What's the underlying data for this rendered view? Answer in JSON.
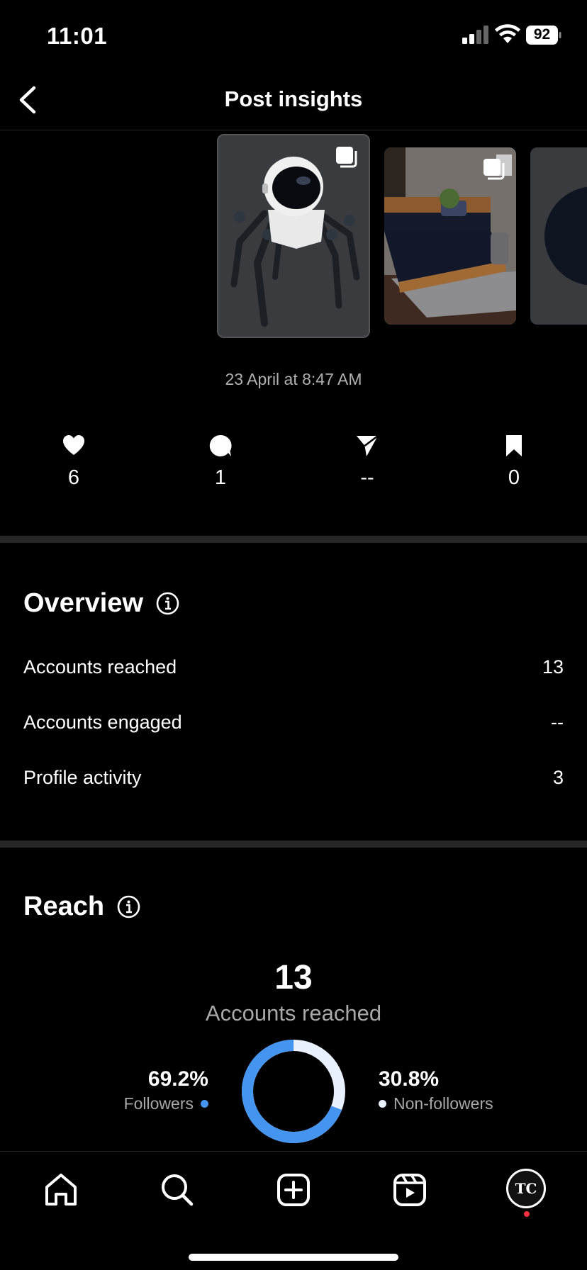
{
  "status_bar": {
    "time": "11:01",
    "battery": "92"
  },
  "nav": {
    "title": "Post insights"
  },
  "carousel": {
    "items": [
      {
        "icon": "multiple-posts-icon",
        "subject": "robot"
      },
      {
        "icon": "multiple-posts-icon",
        "subject": "bedroom"
      },
      {
        "icon": "",
        "subject": "sphere"
      }
    ]
  },
  "post": {
    "date": "23 April at 8:47 AM"
  },
  "stats": {
    "likes": "6",
    "comments": "1",
    "shares": "--",
    "saves": "0"
  },
  "overview": {
    "title": "Overview",
    "rows": [
      {
        "label": "Accounts reached",
        "value": "13"
      },
      {
        "label": "Accounts engaged",
        "value": "--"
      },
      {
        "label": "Profile activity",
        "value": "3"
      }
    ]
  },
  "reach": {
    "title": "Reach",
    "total": "13",
    "total_label": "Accounts reached",
    "followers_pct": "69.2%",
    "followers_label": "Followers",
    "nonfollowers_pct": "30.8%",
    "nonfollowers_label": "Non-followers",
    "followers_fraction": 0.692
  },
  "colors": {
    "followers": "#4494f0",
    "nonfollowers": "#e8f1fd",
    "background": "#000000",
    "notification": "#ff3040"
  },
  "tab_bar": {
    "avatar_text": "TC"
  }
}
